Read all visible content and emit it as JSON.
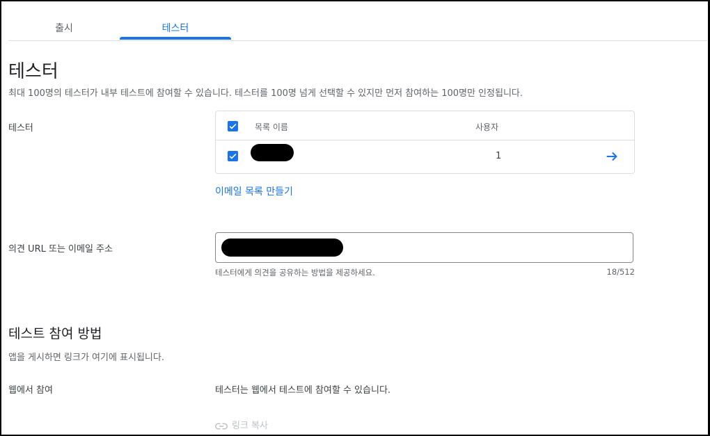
{
  "tabs": [
    {
      "label": "출시"
    },
    {
      "label": "테스터"
    }
  ],
  "title": "테스터",
  "description": "최대 100명의 테스터가 내부 테스트에 참여할 수 있습니다. 테스터를 100명 넘게 선택할 수 있지만 먼저 참여하는 100명만 인정됩니다.",
  "testers": {
    "label": "테스터",
    "columns": {
      "list_name": "목록 이름",
      "users": "사용자"
    },
    "rows": [
      {
        "name": "",
        "users": "1",
        "checked": true
      }
    ],
    "create_list_link": "이메일 목록 만들기"
  },
  "feedback": {
    "label": "의견 URL 또는 이메일 주소",
    "hint": "테스터에게 의견을 공유하는 방법을 제공하세요.",
    "counter": "18/512"
  },
  "join": {
    "title": "테스트 참여 방법",
    "subtitle": "앱을 게시하면 링크가 여기에 표시됩니다.",
    "web_label": "웹에서 참여",
    "web_text": "테스터는 웹에서 테스트에 참여할 수 있습니다.",
    "copy_link": "링크 복사"
  },
  "colors": {
    "accent": "#1a73e8"
  },
  "icons": {
    "checkbox": "check-icon",
    "arrow": "arrow-forward-icon",
    "link": "link-icon"
  }
}
